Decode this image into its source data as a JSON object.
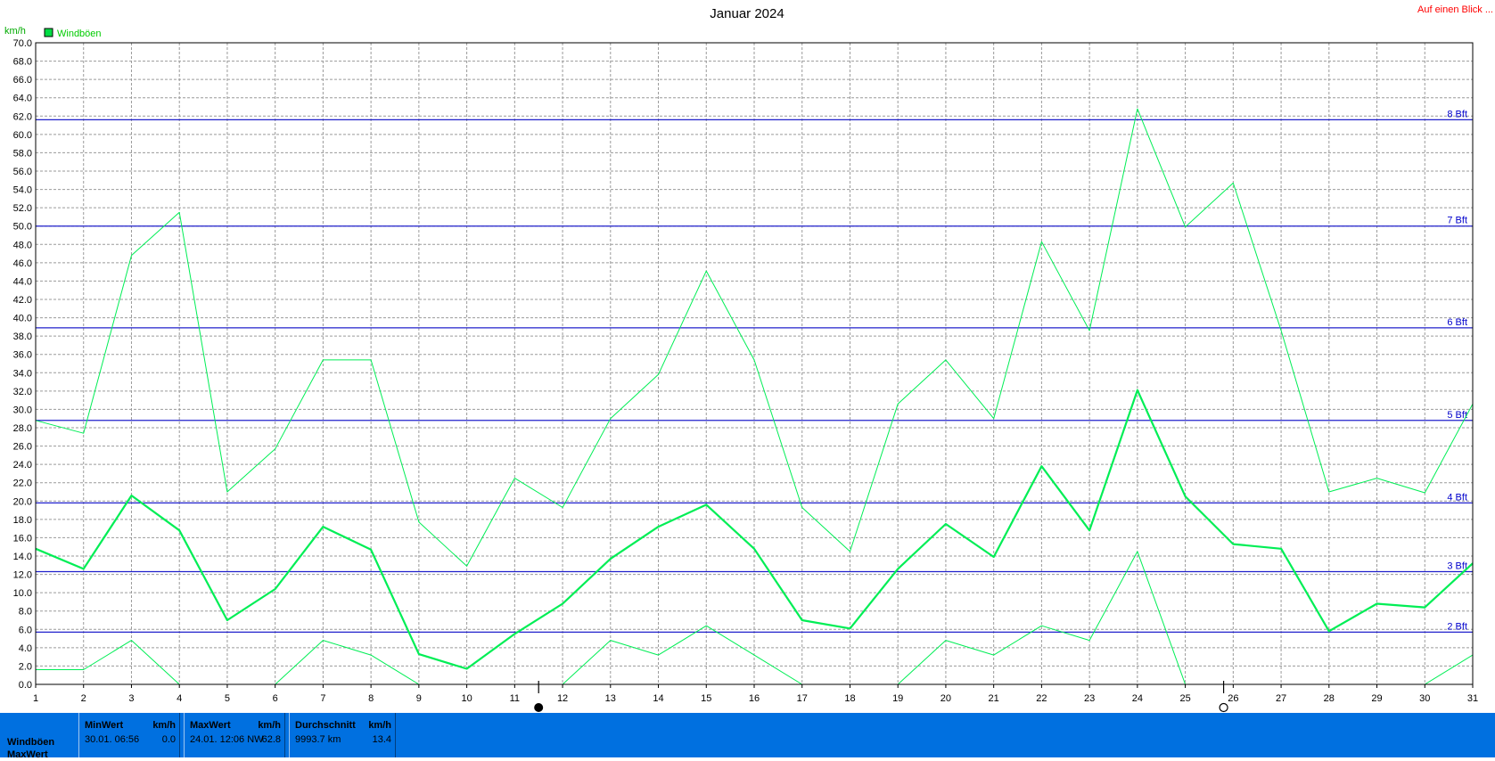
{
  "title": "Januar 2024",
  "corner_link": "Auf einen Blick ...",
  "y_unit": "km/h",
  "legend": {
    "label": "Windböen",
    "color": "#00dd44"
  },
  "colors": {
    "series": "#00ee55",
    "beaufort": "#2020cc",
    "grid": "#9a9a9a",
    "axis": "#000000",
    "footer": "#0070e0"
  },
  "moon_icons": [
    {
      "name": "full-moon-icon",
      "day": 11.5
    },
    {
      "name": "new-moon-icon",
      "day": 25.8
    }
  ],
  "chart_data": {
    "type": "line",
    "title": "Januar 2024",
    "xlabel": "",
    "ylabel": "km/h",
    "x": [
      1,
      2,
      3,
      4,
      5,
      6,
      7,
      8,
      9,
      10,
      11,
      12,
      13,
      14,
      15,
      16,
      17,
      18,
      19,
      20,
      21,
      22,
      23,
      24,
      25,
      26,
      27,
      28,
      29,
      30,
      31
    ],
    "xlim": [
      1,
      31
    ],
    "ylim": [
      0,
      70
    ],
    "ytick_step": 2,
    "grid": true,
    "legend_position": "top-left",
    "series": [
      {
        "name": "Windböen",
        "role": "mean",
        "width": 2.2,
        "values": [
          14.8,
          12.6,
          20.6,
          16.8,
          7.0,
          10.4,
          17.2,
          14.7,
          3.3,
          1.7,
          5.5,
          8.8,
          13.7,
          17.2,
          19.6,
          14.8,
          7.0,
          6.1,
          12.6,
          17.5,
          13.9,
          23.8,
          16.8,
          32.1,
          20.5,
          15.3,
          14.8,
          5.8,
          8.8,
          8.4,
          13.2
        ]
      },
      {
        "role": "max",
        "width": 1,
        "values": [
          28.8,
          27.4,
          46.8,
          51.5,
          21.0,
          25.7,
          35.4,
          35.4,
          17.7,
          12.9,
          22.5,
          19.3,
          29.0,
          33.8,
          45.1,
          35.4,
          19.3,
          14.5,
          30.6,
          35.4,
          29.0,
          48.3,
          38.6,
          62.8,
          49.9,
          54.7,
          38.6,
          21.0,
          22.5,
          20.9,
          30.6
        ]
      },
      {
        "role": "min",
        "width": 1,
        "values": [
          1.6,
          1.6,
          4.8,
          0.0,
          null,
          0.0,
          4.8,
          3.2,
          0.0,
          null,
          null,
          0.0,
          4.8,
          3.2,
          6.4,
          3.2,
          0.0,
          null,
          0.0,
          4.8,
          3.2,
          6.4,
          4.8,
          14.5,
          0.0,
          null,
          null,
          null,
          null,
          0.0,
          3.2
        ]
      }
    ],
    "beaufort_lines": [
      {
        "label": "2 Bft",
        "value": 5.7
      },
      {
        "label": "3 Bft",
        "value": 12.3
      },
      {
        "label": "4 Bft",
        "value": 19.8
      },
      {
        "label": "5 Bft",
        "value": 28.8
      },
      {
        "label": "6 Bft",
        "value": 38.9
      },
      {
        "label": "7 Bft",
        "value": 50.0
      },
      {
        "label": "8 Bft",
        "value": 61.6
      }
    ]
  },
  "footer": {
    "row_labels": [
      "Windböen",
      "MaxWert"
    ],
    "boxes": [
      {
        "name": "min-box",
        "header": "MinWert",
        "unit": "km/h",
        "left_value": "30.01.  06:56",
        "right_value": "0.0"
      },
      {
        "name": "max-box",
        "header": "MaxWert",
        "unit": "km/h",
        "left_value": "24.01.  12:06 NW",
        "right_value": "62.8"
      },
      {
        "name": "avg-box",
        "header": "Durchschnitt",
        "unit": "km/h",
        "left_value": "9993.7 km",
        "right_value": "13.4"
      }
    ]
  }
}
